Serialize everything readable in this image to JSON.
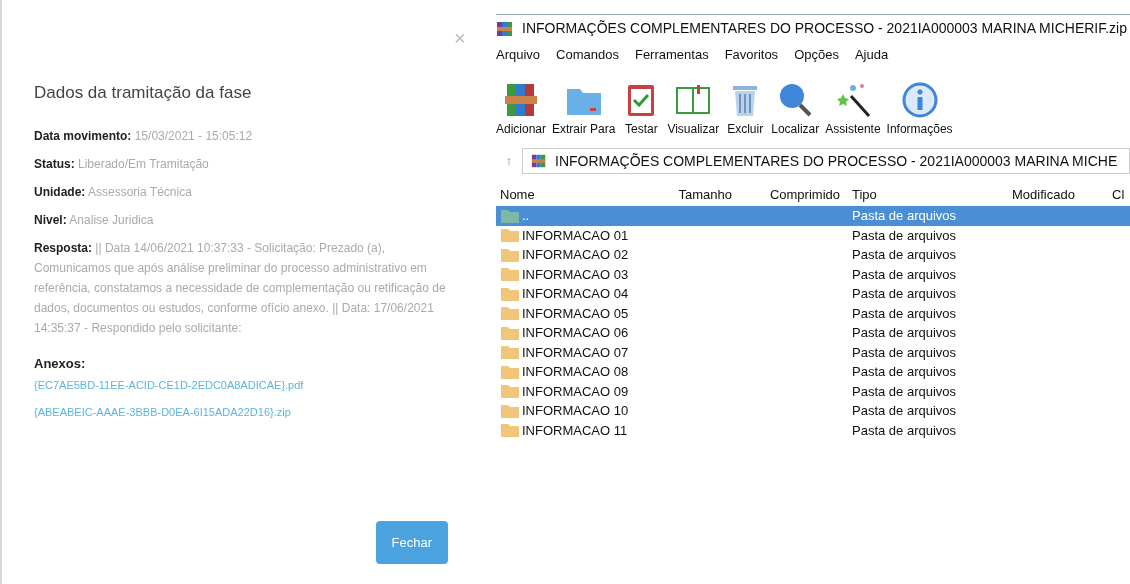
{
  "dialog": {
    "title": "Dados da tramitação da fase",
    "close": "×",
    "fields": [
      "**Data movimento:** 15/03/2021 - 15:05:12",
      "**Status:** Liberado/Em Tramitação",
      "**Unidade:** Assessoria Técnica",
      "**Nivel:** Analise Juridica",
      "**Resposta:** || Data 14/06/2021 10:37:33 - Solicitação: Prezado (a), Comunicamos que após análise preliminar do processo administrativo em referência, constatamos a necessidade de complementação ou retificação de dados, documentos ou estudos, conforme ofício anexo. || Data: 17/06/2021 14:35:37 - Respondido pelo solicitante:"
    ],
    "attachments_label": "Anexos:",
    "attachments": [
      "{EC7AE5BD-11EE-ACID-CE1D-2EDC0A8ADICAE}.pdf",
      "{ABEABEIC-AAAE-3BBB-D0EA-6I15ADA22D16}.zip"
    ],
    "button": "Fechar"
  },
  "archiver": {
    "title": "INFORMAÇÕES COMPLEMENTARES DO PROCESSO - 2021IA000003 MARINA MICHERIF.zip",
    "menu": [
      "Arquivo",
      "Comandos",
      "Ferramentas",
      "Favoritos",
      "Opções",
      "Ajuda"
    ],
    "toolbar": [
      {
        "kind": "add",
        "label": "Adicionar"
      },
      {
        "kind": "extract",
        "label": "Extrair Para"
      },
      {
        "kind": "test",
        "label": "Testar"
      },
      {
        "kind": "view",
        "label": "Visualizar"
      },
      {
        "kind": "delete",
        "label": "Excluir"
      },
      {
        "kind": "find",
        "label": "Localizar"
      },
      {
        "kind": "wizard",
        "label": "Assistente"
      },
      {
        "kind": "info",
        "label": "Informações"
      }
    ],
    "up": "↑",
    "path": "INFORMAÇÕES COMPLEMENTARES DO PROCESSO - 2021IA000003 MARINA MICHE",
    "columns": [
      "Nome",
      "Tamanho",
      "Comprimido",
      "Tipo",
      "Modificado",
      "Cl"
    ],
    "rows": [
      {
        "name": "..",
        "type": "Pasta de arquivos",
        "selected": true
      },
      {
        "name": "INFORMACAO 01",
        "type": "Pasta de arquivos",
        "selected": false
      },
      {
        "name": "INFORMACAO 02",
        "type": "Pasta de arquivos",
        "selected": false
      },
      {
        "name": "INFORMACAO 03",
        "type": "Pasta de arquivos",
        "selected": false
      },
      {
        "name": "INFORMACAO 04",
        "type": "Pasta de arquivos",
        "selected": false
      },
      {
        "name": "INFORMACAO 05",
        "type": "Pasta de arquivos",
        "selected": false
      },
      {
        "name": "INFORMACAO 06",
        "type": "Pasta de arquivos",
        "selected": false
      },
      {
        "name": "INFORMACAO 07",
        "type": "Pasta de arquivos",
        "selected": false
      },
      {
        "name": "INFORMACAO 08",
        "type": "Pasta de arquivos",
        "selected": false
      },
      {
        "name": "INFORMACAO 09",
        "type": "Pasta de arquivos",
        "selected": false
      },
      {
        "name": "INFORMACAO 10",
        "type": "Pasta de arquivos",
        "selected": false
      },
      {
        "name": "INFORMACAO 11",
        "type": "Pasta de arquivos",
        "selected": false
      }
    ]
  }
}
